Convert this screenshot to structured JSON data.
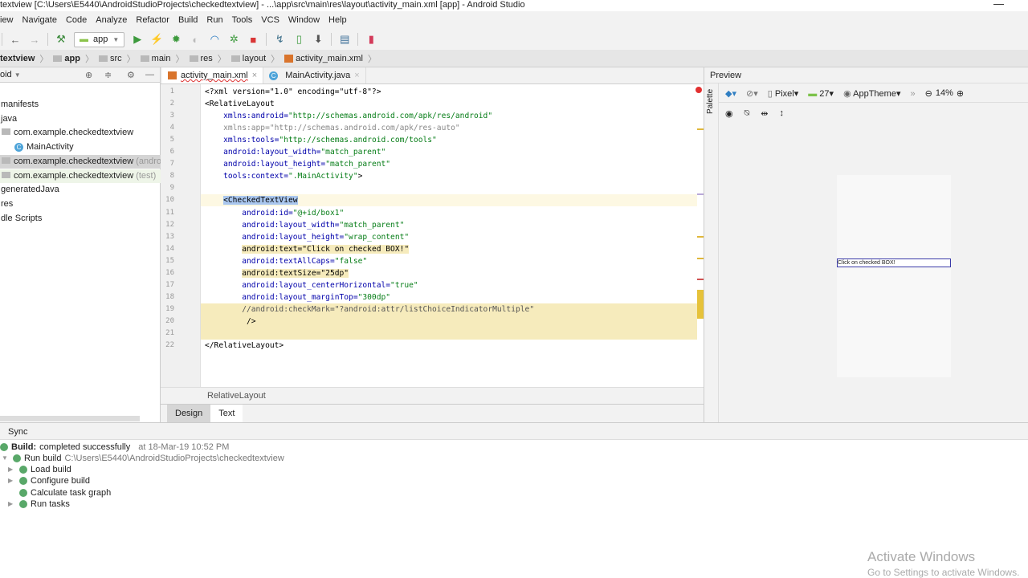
{
  "window": {
    "title": "textview [C:\\Users\\E5440\\AndroidStudioProjects\\checkedtextview] - ...\\app\\src\\main\\res\\layout\\activity_main.xml [app] - Android Studio",
    "close": "—"
  },
  "menu": [
    "iew",
    "Navigate",
    "Code",
    "Analyze",
    "Refactor",
    "Build",
    "Run",
    "Tools",
    "VCS",
    "Window",
    "Help"
  ],
  "toolbar": {
    "run_config": "app"
  },
  "breadcrumbs": [
    "textview",
    "app",
    "src",
    "main",
    "res",
    "layout",
    "activity_main.xml"
  ],
  "project": {
    "view_mode": "oid",
    "items": [
      {
        "label": "manifests",
        "indent": 0
      },
      {
        "label": "java",
        "indent": 0
      },
      {
        "label": "com.example.checkedtextview",
        "indent": 1,
        "icon": "folder"
      },
      {
        "label": "MainActivity",
        "indent": 2,
        "icon": "class"
      },
      {
        "label": "com.example.checkedtextview",
        "suffix": "(androidTest)",
        "indent": 1,
        "icon": "folder",
        "selected": true
      },
      {
        "label": "com.example.checkedtextview",
        "suffix": "(test)",
        "indent": 1,
        "icon": "folder",
        "tint": true
      },
      {
        "label": "generatedJava",
        "indent": 0
      },
      {
        "label": "res",
        "indent": 0
      },
      {
        "label": "dle Scripts",
        "indent": 0
      }
    ]
  },
  "editor": {
    "tabs": [
      {
        "label": "activity_main.xml",
        "active": true
      },
      {
        "label": "MainActivity.java",
        "active": false
      }
    ],
    "lines": [
      [
        [
          "<?xml version=\"1.0\" encoding=\"utf-8\"?>",
          "tag"
        ]
      ],
      [
        [
          "<RelativeLayout",
          "tag"
        ]
      ],
      [
        [
          "    xmlns:android=",
          "attr"
        ],
        [
          "\"http://schemas.android.com/apk/res/android\"",
          "str"
        ]
      ],
      [
        [
          "    xmlns:app=\"http://schemas.android.com/apk/res-auto\"",
          "grey"
        ]
      ],
      [
        [
          "    xmlns:tools=",
          "attr"
        ],
        [
          "\"http://schemas.android.com/tools\"",
          "str"
        ]
      ],
      [
        [
          "    android:layout_width=",
          "attr"
        ],
        [
          "\"match_parent\"",
          "str"
        ]
      ],
      [
        [
          "    android:layout_height=",
          "attr"
        ],
        [
          "\"match_parent\"",
          "str"
        ]
      ],
      [
        [
          "    tools:context=",
          "attr"
        ],
        [
          "\".MainActivity\"",
          "str"
        ],
        [
          ">",
          "tag"
        ]
      ],
      [
        [
          "",
          "tag"
        ]
      ],
      [
        [
          "    ",
          "tag"
        ],
        [
          "<CheckedTextView",
          "tag"
        ]
      ],
      [
        [
          "        android:id=",
          "attr"
        ],
        [
          "\"@+id/box1\"",
          "str"
        ]
      ],
      [
        [
          "        android:layout_width=",
          "attr"
        ],
        [
          "\"match_parent\"",
          "str"
        ]
      ],
      [
        [
          "        android:layout_height=",
          "attr"
        ],
        [
          "\"wrap_content\"",
          "str"
        ]
      ],
      [
        [
          "        ",
          "tag"
        ],
        [
          "android:text=\"Click on checked BOX!\"",
          "hl"
        ]
      ],
      [
        [
          "        android:textAllCaps=",
          "attr"
        ],
        [
          "\"false\"",
          "str"
        ]
      ],
      [
        [
          "        ",
          "tag"
        ],
        [
          "android:textSize=\"25dp\"",
          "hl"
        ]
      ],
      [
        [
          "        android:layout_centerHorizontal=",
          "attr"
        ],
        [
          "\"true\"",
          "str"
        ]
      ],
      [
        [
          "        android:layout_marginTop=",
          "attr"
        ],
        [
          "\"300dp\"",
          "str"
        ]
      ],
      [
        [
          "        //android:checkMark=\"?android:attr/listChoiceIndicatorMultiple\"",
          "com"
        ]
      ],
      [
        [
          "         />",
          "tag"
        ]
      ],
      [
        [
          "",
          "tag"
        ]
      ],
      [
        [
          "</RelativeLayout>",
          "tag"
        ]
      ]
    ],
    "highlight_rows": [
      19,
      20,
      21
    ],
    "current_row": 10,
    "footer_breadcrumb": "RelativeLayout",
    "mode_tabs": [
      "Design",
      "Text"
    ],
    "active_mode": "Text"
  },
  "preview": {
    "title": "Preview",
    "palette": "Palette",
    "device": "Pixel",
    "api": "27",
    "theme": "AppTheme",
    "zoom": "14%",
    "rendered_text": "Click on checked BOX!"
  },
  "build": {
    "tab": "Sync",
    "status_label": "Build:",
    "status": "completed successfully",
    "time": "at 18-Mar-19 10:52 PM",
    "run_label": "Run build",
    "run_path": "C:\\Users\\E5440\\AndroidStudioProjects\\checkedtextview",
    "tasks": [
      {
        "label": "Load build",
        "expandable": true
      },
      {
        "label": "Configure build",
        "expandable": true
      },
      {
        "label": "Calculate task graph",
        "expandable": false
      },
      {
        "label": "Run tasks",
        "expandable": true
      }
    ]
  },
  "watermark": {
    "line1": "Activate Windows",
    "line2": "Go to Settings to activate Windows."
  }
}
